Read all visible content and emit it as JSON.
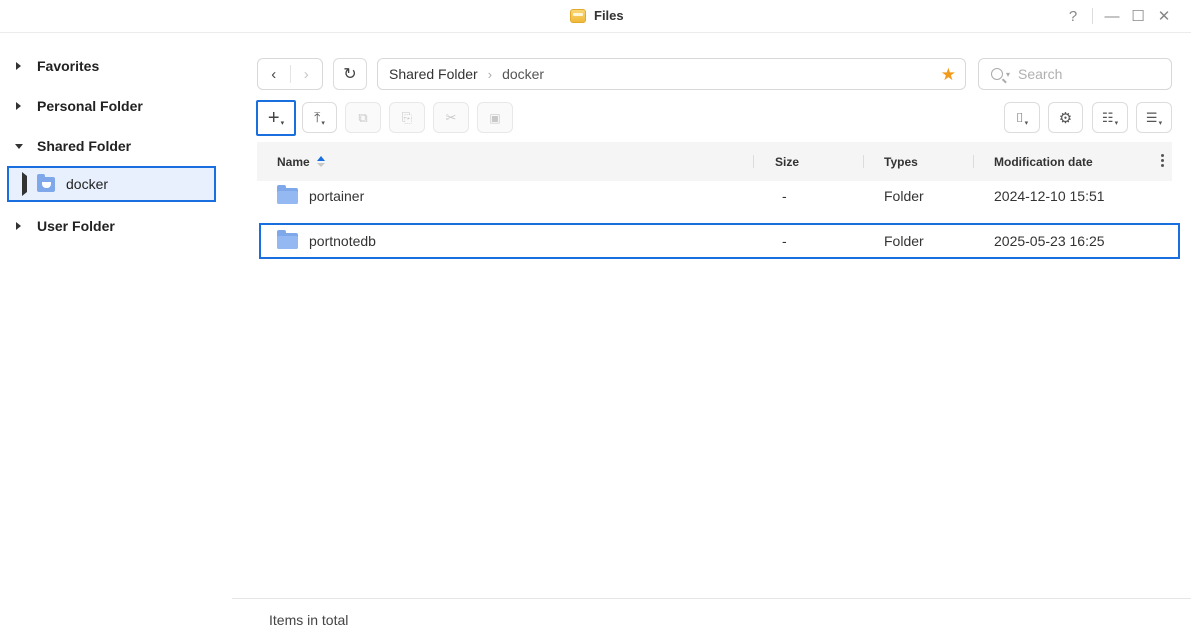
{
  "window": {
    "title": "Files",
    "help": "?",
    "minimize": "—",
    "maximize": "☐",
    "close": "✕"
  },
  "sidebar": {
    "items": [
      {
        "label": "Favorites"
      },
      {
        "label": "Personal Folder"
      },
      {
        "label": "Shared Folder"
      },
      {
        "label": "User Folder"
      }
    ],
    "sub_item": {
      "label": "docker"
    }
  },
  "nav": {
    "back": "‹",
    "forward": "›",
    "refresh": "↻"
  },
  "path": {
    "root": "Shared Folder",
    "separator": "›",
    "current": "docker",
    "star": "★"
  },
  "search": {
    "placeholder": "Search",
    "dropdown": "▾"
  },
  "toolbar": {
    "create": "+",
    "upload": "⤒",
    "copy": "⧉",
    "paste": "⎘",
    "cut": "✂",
    "clipboard": "▣",
    "tools": "⌷",
    "settings": "⚙",
    "view": "☷",
    "sort": "☰"
  },
  "table": {
    "columns": {
      "name": "Name",
      "size": "Size",
      "types": "Types",
      "modified": "Modification date"
    },
    "rows": [
      {
        "name": "portainer",
        "size": "-",
        "type": "Folder",
        "modified": "2024-12-10 15:51"
      },
      {
        "name": "portnotedb",
        "size": "-",
        "type": "Folder",
        "modified": "2025-05-23 16:25"
      }
    ]
  },
  "footer": {
    "items_label": "Items in total"
  },
  "colors": {
    "accent": "#1a6fe0",
    "folder": "#7fa8ea",
    "star": "#f29a1b"
  }
}
